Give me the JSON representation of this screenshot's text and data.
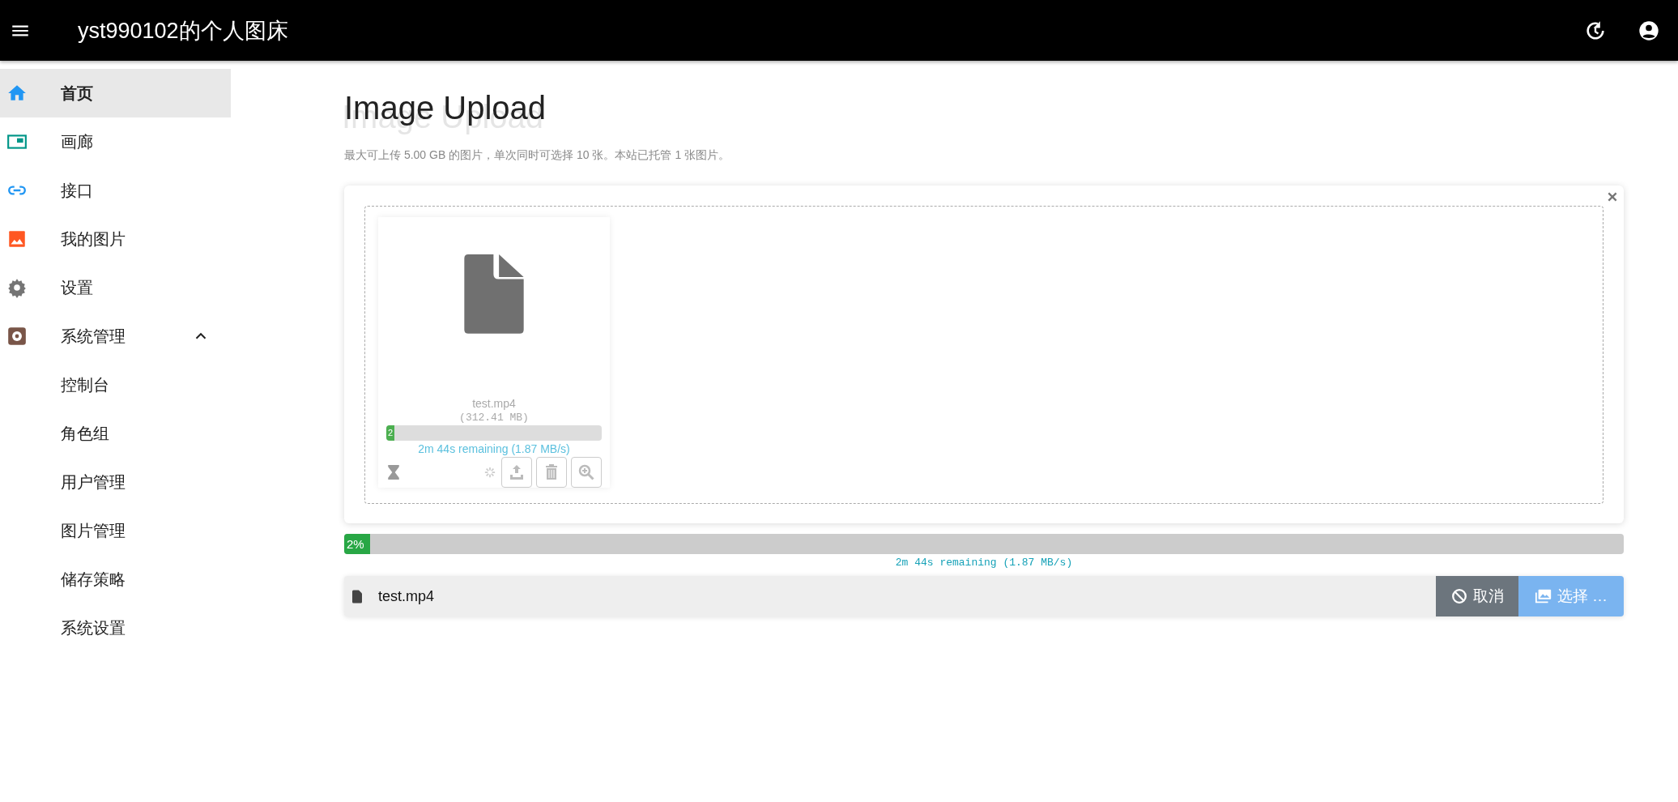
{
  "app_bar": {
    "title": "yst990102的个人图床"
  },
  "sidebar": {
    "items": [
      {
        "label": "首页",
        "kind": "home",
        "selected": true
      },
      {
        "label": "画廊",
        "kind": "gallery",
        "selected": false
      },
      {
        "label": "接口",
        "kind": "link",
        "selected": false
      },
      {
        "label": "我的图片",
        "kind": "image",
        "selected": false
      },
      {
        "label": "设置",
        "kind": "gear",
        "selected": false
      },
      {
        "label": "系统管理",
        "kind": "admin",
        "selected": false,
        "expanded": true,
        "children": [
          {
            "label": "控制台",
            "selected": false
          },
          {
            "label": "角色组",
            "selected": false
          },
          {
            "label": "用户管理",
            "selected": false
          },
          {
            "label": "图片管理",
            "selected": false
          },
          {
            "label": "储存策略",
            "selected": false
          },
          {
            "label": "系统设置",
            "selected": false
          }
        ]
      }
    ]
  },
  "page": {
    "title": "Image Upload",
    "subtitle": "最大可上传 5.00 GB 的图片，单次同时可选择 10 张。本站已托管 1 张图片。"
  },
  "upload": {
    "files": [
      {
        "name": "test.mp4",
        "size": "(312.41 MB)",
        "progress": {
          "level": 0.02,
          "label": "2"
        },
        "remaining": "2m 44s remaining (1.87 MB/s)"
      }
    ],
    "progress": {
      "level": 0.02,
      "label": "2%"
    },
    "remaining": "2m 44s remaining (1.87 MB/s)",
    "caption": "test.mp4",
    "buttons": [
      {
        "label": "取消",
        "kind": "cancel"
      },
      {
        "label": "选择 …",
        "kind": "browse"
      }
    ]
  }
}
